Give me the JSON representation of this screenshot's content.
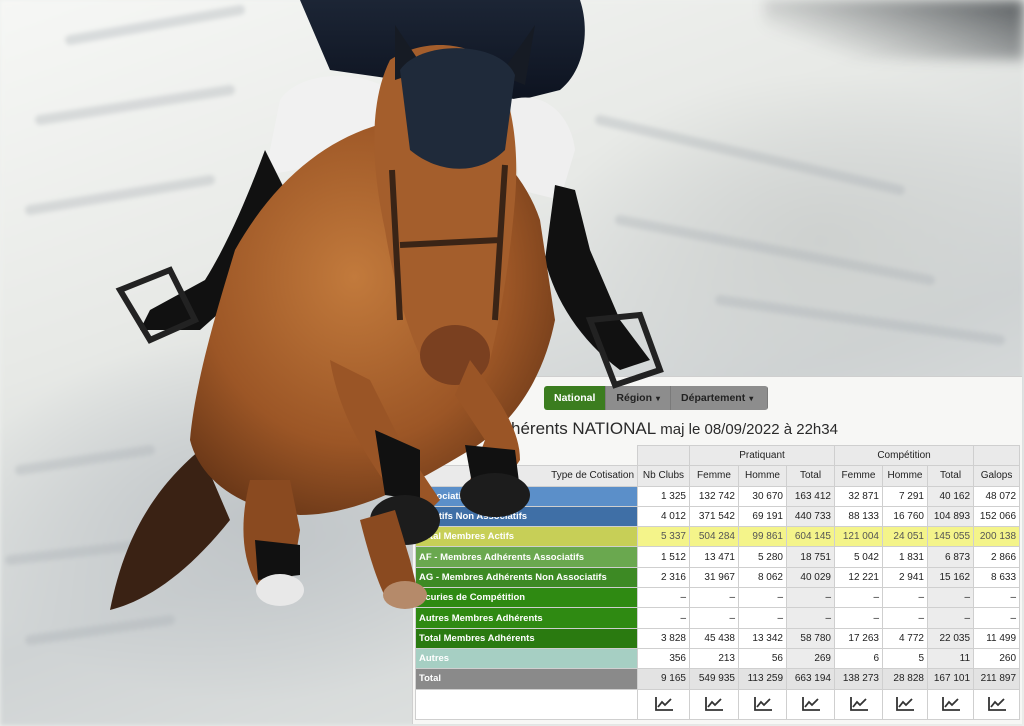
{
  "tabs": [
    {
      "label": "National",
      "active": true
    },
    {
      "label": "Région",
      "dropdown": true
    },
    {
      "label": "Département",
      "dropdown": true
    }
  ],
  "title": {
    "main": "hérents NATIONAL",
    "update": "maj le 08/09/2022 à 22h34"
  },
  "table": {
    "group_headers": {
      "pratiquant": "Pratiquant",
      "competition": "Compétition"
    },
    "columns": [
      "Type de Cotisation",
      "Nb Clubs",
      "Femme",
      "Homme",
      "Total",
      "Femme",
      "Homme",
      "Total",
      "Galops"
    ],
    "rows": [
      {
        "label": "Associatifs",
        "color": "#5b8fc9",
        "values": [
          "1 325",
          "132 742",
          "30 670",
          "163 412",
          "32 871",
          "7 291",
          "40 162",
          "48 072"
        ]
      },
      {
        "label": "s Actifs Non Associatifs",
        "color": "#3f6fa6",
        "values": [
          "4 012",
          "371 542",
          "69 191",
          "440 733",
          "88 133",
          "16 760",
          "104 893",
          "152 066"
        ]
      },
      {
        "label": "Total Membres Actifs",
        "color": "#c7cf57",
        "highlight": true,
        "values": [
          "5 337",
          "504 284",
          "99 861",
          "604 145",
          "121 004",
          "24 051",
          "145 055",
          "200 138"
        ]
      },
      {
        "label": "AF - Membres Adhérents Associatifs",
        "color": "#6aa84f",
        "values": [
          "1 512",
          "13 471",
          "5 280",
          "18 751",
          "5 042",
          "1 831",
          "6 873",
          "2 866"
        ]
      },
      {
        "label": "AG - Membres Adhérents Non Associatifs",
        "color": "#3d8a24",
        "values": [
          "2 316",
          "31 967",
          "8 062",
          "40 029",
          "12 221",
          "2 941",
          "15 162",
          "8 633"
        ]
      },
      {
        "label": "Ecuries de Compétition",
        "color": "#2f8a12",
        "values": [
          "–",
          "–",
          "–",
          "–",
          "–",
          "–",
          "–",
          "–"
        ]
      },
      {
        "label": "Autres Membres Adhérents",
        "color": "#2f8a12",
        "values": [
          "–",
          "–",
          "–",
          "–",
          "–",
          "–",
          "–",
          "–"
        ]
      },
      {
        "label": "Total Membres Adhérents",
        "color": "#2a7a10",
        "values": [
          "3 828",
          "45 438",
          "13 342",
          "58 780",
          "17 263",
          "4 772",
          "22 035",
          "11 499"
        ]
      },
      {
        "label": "Autres",
        "color": "#a6cfc3",
        "values": [
          "356",
          "213",
          "56",
          "269",
          "6",
          "5",
          "11",
          "260"
        ]
      },
      {
        "label": "Total",
        "color": "#8a8a8a",
        "grey": true,
        "values": [
          "9 165",
          "549 935",
          "113 259",
          "663 194",
          "138 273",
          "28 828",
          "167 101",
          "211 897"
        ]
      }
    ],
    "chart_icon": "line-chart-icon"
  }
}
